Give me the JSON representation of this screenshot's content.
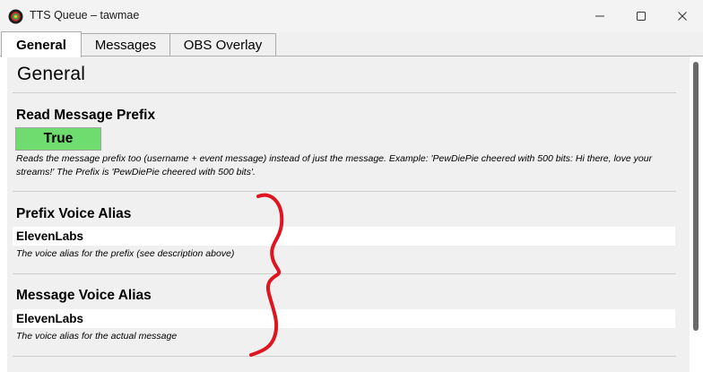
{
  "window": {
    "title": "TTS Queue – tawmae"
  },
  "tabs": [
    {
      "label": "General",
      "active": true
    },
    {
      "label": "Messages",
      "active": false
    },
    {
      "label": "OBS Overlay",
      "active": false
    }
  ],
  "page": {
    "title": "General"
  },
  "read_prefix": {
    "label": "Read Message Prefix",
    "value": "True",
    "value_color": "#6edc6e",
    "description": "Reads the message prefix too (username + event message) instead of just the message. Example: 'PewDiePie cheered with 500 bits: Hi there, love your streams!' The Prefix is 'PewDiePie cheered with 500 bits'."
  },
  "prefix_voice": {
    "label": "Prefix Voice Alias",
    "value": "ElevenLabs",
    "description": "The voice alias for the prefix (see description above)"
  },
  "message_voice": {
    "label": "Message Voice Alias",
    "value": "ElevenLabs",
    "description": "The voice alias for the actual message"
  },
  "annotation_color": "#e0141e",
  "icons": [
    "app-logo-icon",
    "minimize-icon",
    "maximize-icon",
    "close-icon"
  ]
}
